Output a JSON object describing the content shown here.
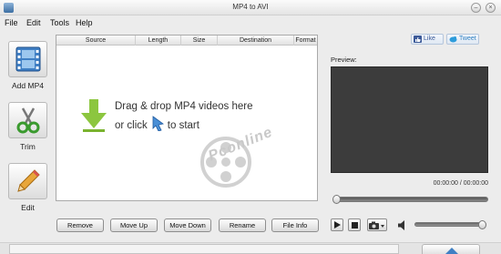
{
  "window": {
    "title": "MP4 to AVI"
  },
  "menu": [
    "File",
    "Edit",
    "Tools",
    "Help"
  ],
  "sidebar": [
    {
      "label": "Add MP4",
      "icon": "film-icon"
    },
    {
      "label": "Trim",
      "icon": "scissors-icon"
    },
    {
      "label": "Edit",
      "icon": "pencil-icon"
    }
  ],
  "file_list": {
    "columns": [
      "Source",
      "Length",
      "Size",
      "Destination",
      "Format"
    ],
    "rows": [],
    "drop_hint_line1": "Drag & drop MP4 videos here",
    "drop_hint_line2_pre": "or click",
    "drop_hint_line2_post": "to start",
    "watermark": "Pconline"
  },
  "buttons": [
    "Remove",
    "Move Up",
    "Move Down",
    "Rename",
    "File Info"
  ],
  "social": {
    "like": "Like",
    "tweet": "Tweet"
  },
  "preview": {
    "label": "Preview:",
    "time": "00:00:00 / 00:00:00",
    "seek_position": 0,
    "volume_level": 1
  },
  "colors": {
    "preview_bg": "#3c3c3c",
    "drop_arrow": "#8cc63f",
    "click_icon": "#4a8fd6",
    "facebook": "#3b5998",
    "twitter": "#2d9cdb"
  }
}
